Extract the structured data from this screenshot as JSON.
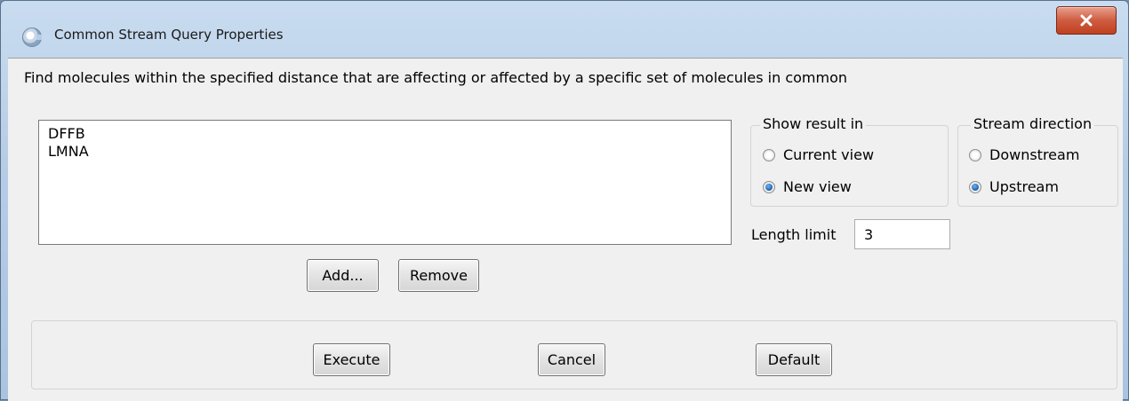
{
  "window": {
    "title": "Common Stream Query Properties",
    "close_icon": "close-icon"
  },
  "description": "Find molecules within the specified distance that are affecting or affected by a specific set of molecules in common",
  "molecules": [
    "DFFB",
    "LMNA"
  ],
  "list_buttons": {
    "add_label": "Add...",
    "remove_label": "Remove"
  },
  "show_result_in": {
    "title": "Show result in",
    "options": [
      {
        "label": "Current view",
        "selected": false
      },
      {
        "label": "New view",
        "selected": true
      }
    ]
  },
  "stream_direction": {
    "title": "Stream direction",
    "options": [
      {
        "label": "Downstream",
        "selected": false
      },
      {
        "label": "Upstream",
        "selected": true
      }
    ]
  },
  "length_limit": {
    "label": "Length limit",
    "value": "3"
  },
  "footer": {
    "execute_label": "Execute",
    "cancel_label": "Cancel",
    "default_label": "Default"
  },
  "colors": {
    "close_button": "#cf5c41",
    "radio_selected": "#1f5fb0",
    "dialog_background": "#f0f0f0"
  }
}
